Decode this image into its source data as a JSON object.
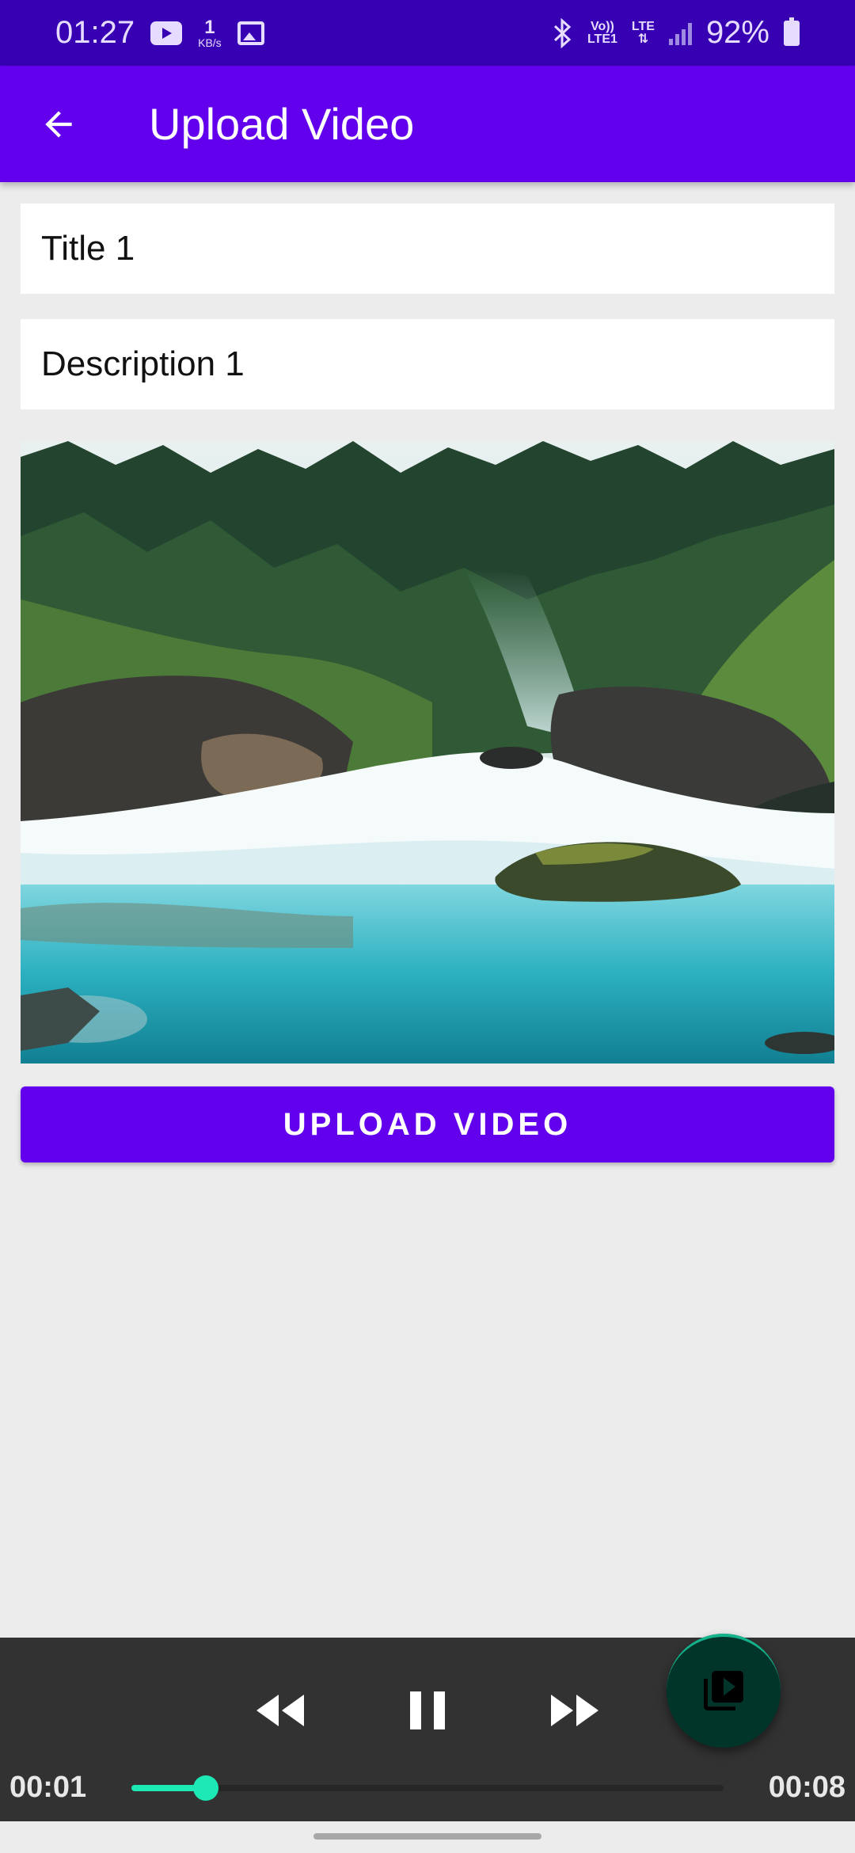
{
  "status_bar": {
    "time": "01:27",
    "net_speed_value": "1",
    "net_speed_unit": "KB/s",
    "volte_top": "Vo))",
    "volte_bottom": "LTE1",
    "lte_label": "LTE",
    "battery": "92%",
    "icons": [
      "youtube-icon",
      "image-icon",
      "bluetooth-icon",
      "signal-icon",
      "battery-icon"
    ]
  },
  "app_bar": {
    "title": "Upload Video",
    "back_icon": "arrow-left-icon"
  },
  "form": {
    "title_value": "Title 1",
    "description_value": "Description 1"
  },
  "upload_button_label": "UPLOAD VIDEO",
  "player": {
    "current_time": "00:01",
    "total_time": "00:08",
    "progress": 0.125,
    "accent": "#1de9b6"
  },
  "colors": {
    "primary": "#6200ee",
    "primary_dark": "#3700b3",
    "player_bg": "#323232"
  }
}
